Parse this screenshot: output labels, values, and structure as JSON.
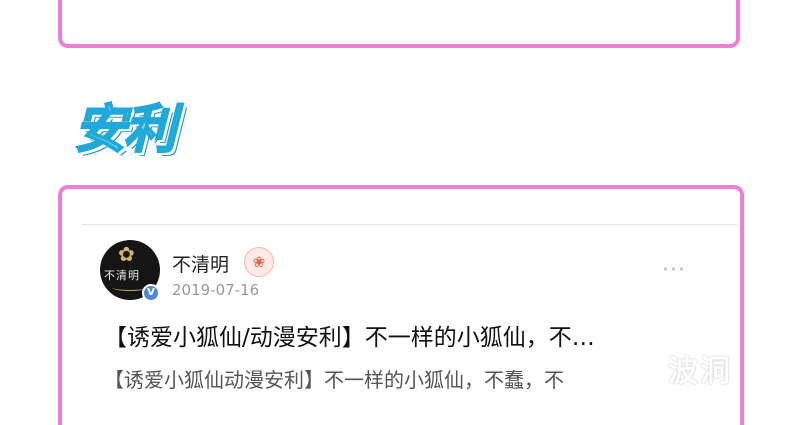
{
  "section": {
    "title": "安利"
  },
  "post": {
    "username": "不清明",
    "date": "2019-07-16",
    "title": "【诱爱小狐仙/动漫安利】不一样的小狐仙，不…",
    "excerpt": "【诱爱小狐仙动漫安利】不一样的小狐仙，不蠢，不",
    "more_label": "···",
    "avatar": {
      "glyph_text": "不清明"
    },
    "verified": {
      "label": "V"
    },
    "badge": {
      "glyph": "❀"
    }
  },
  "watermark": {
    "text": "波洞"
  },
  "colors": {
    "frame": "#ee7ed6",
    "title_fill": "#7ed9f0",
    "title_outline": "#1fa8d8",
    "verified": "#4f88d8"
  }
}
